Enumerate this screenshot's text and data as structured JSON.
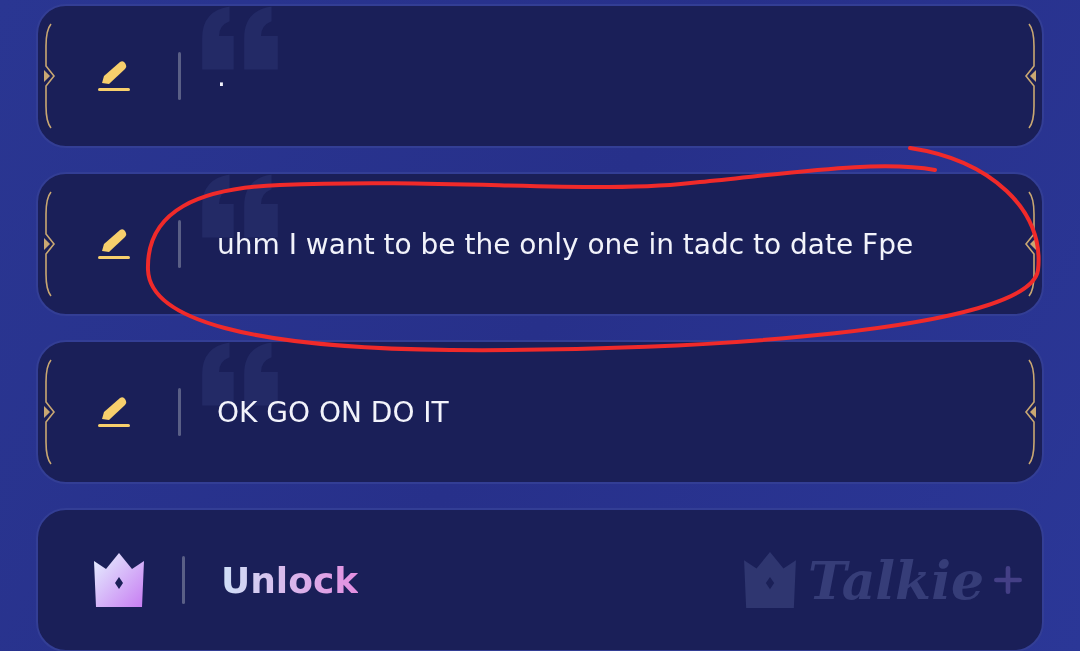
{
  "items": [
    {
      "kind": "line",
      "text": "."
    },
    {
      "kind": "line",
      "text": "uhm I want to be the only one in tadc to date Fpe"
    },
    {
      "kind": "line",
      "text": "OK GO ON DO IT"
    },
    {
      "kind": "unlock",
      "text": "Unlock",
      "badge": "Talkie"
    }
  ]
}
